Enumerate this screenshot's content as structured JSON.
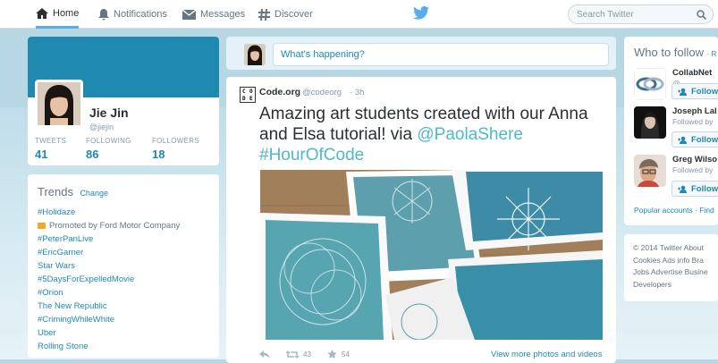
{
  "nav": {
    "home": "Home",
    "notifications": "Notifications",
    "messages": "Messages",
    "discover": "Discover",
    "search_placeholder": "Search Twitter"
  },
  "profile": {
    "name": "Jie Jin",
    "handle": "@jiejin",
    "stats": [
      {
        "label": "TWEETS",
        "value": "41"
      },
      {
        "label": "FOLLOWING",
        "value": "86"
      },
      {
        "label": "FOLLOWERS",
        "value": "18"
      }
    ]
  },
  "trends": {
    "title": "Trends",
    "change": "Change",
    "items": [
      {
        "text": "#Holidaze"
      },
      {
        "text": "Promoted by Ford Motor Company",
        "promoted": true
      },
      {
        "text": "#PeterPanLive"
      },
      {
        "text": "#EricGarner"
      },
      {
        "text": "Star Wars"
      },
      {
        "text": "#5DaysForExpelledMovie"
      },
      {
        "text": "#Orion"
      },
      {
        "text": "The New Republic"
      },
      {
        "text": "#CrimingWhileWhite"
      },
      {
        "text": "Uber"
      },
      {
        "text": "Rolling Stone"
      }
    ]
  },
  "compose": {
    "placeholder": "What's happening?"
  },
  "tweet": {
    "author": "Code.org",
    "handle": "@codeorg",
    "separator": "·",
    "time": "3h",
    "text_main": "Amazing art students created with our Anna and Elsa tutorial! via ",
    "mention": "@PaolaShere",
    "hashtag": "#HourOfCode",
    "retweets": "43",
    "favorites": "54",
    "view_more": "View more photos and videos",
    "logo_letters": [
      "C",
      "O",
      "D",
      "E"
    ]
  },
  "who_to_follow": {
    "title": "Who to follow",
    "separator": "·",
    "refresh": "R",
    "follow_label": "Follow",
    "suggestions": [
      {
        "name": "CollabNet",
        "sub": "@"
      },
      {
        "name": "Joseph Lal",
        "sub": "Followed by"
      },
      {
        "name": "Greg Wilso",
        "sub": "Followed by"
      }
    ],
    "footer": "Popular accounts · Find"
  },
  "footer_links": {
    "line1": "© 2014 Twitter   About",
    "line2": "Cookies   Ads info   Bra",
    "line3": "Jobs   Advertise   Busine",
    "line4": "Developers"
  },
  "colors": {
    "accent": "#1f89b0",
    "twitter_blue": "#55acee",
    "link_teal": "#4fb8c9"
  }
}
